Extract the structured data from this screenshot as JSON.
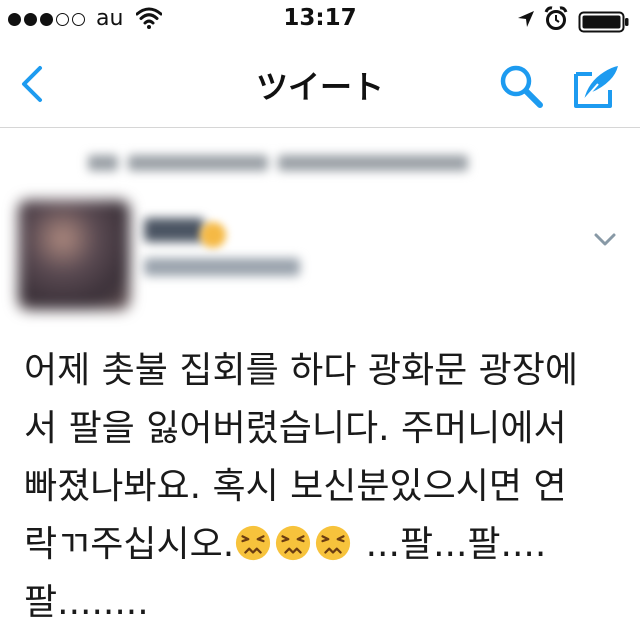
{
  "status_bar": {
    "carrier": "au",
    "time": "13:17",
    "signal_bars_filled": 3,
    "signal_bars_total": 5
  },
  "nav": {
    "title": "ツイート"
  },
  "tweet": {
    "lines": [
      "어제 촛불 집회를 하다 광화문 광장에",
      "서 팔을 잃어버렸습니다. 주머니에서",
      "빠졌나봐요. 혹시 보신분있으시면 연",
      "락ㄲ주십시오.",
      "팔........"
    ],
    "line4_tail": " ...팔...팔....",
    "emoji": [
      "persevering-face-emoji",
      "persevering-face-emoji",
      "persevering-face-emoji"
    ]
  },
  "colors": {
    "accent": "#1d9bf0",
    "text": "#1a1a1a",
    "divider": "#d6d6d6"
  }
}
